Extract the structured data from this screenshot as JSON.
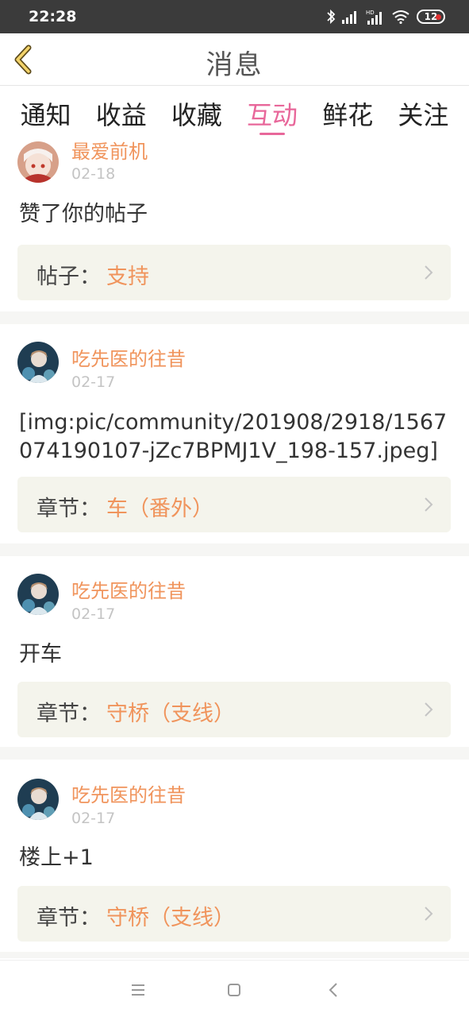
{
  "status_bar": {
    "time": "22:28",
    "battery": "12"
  },
  "header": {
    "title": "消息"
  },
  "tabs": [
    {
      "label": "通知",
      "active": false
    },
    {
      "label": "收益",
      "active": false
    },
    {
      "label": "收藏",
      "active": false
    },
    {
      "label": "互动",
      "active": true
    },
    {
      "label": "鲜花",
      "active": false
    },
    {
      "label": "关注",
      "active": false
    }
  ],
  "messages": [
    {
      "author": "最爱前机",
      "date": "02-18",
      "content": "赞了你的帖子",
      "ref_label": "帖子：",
      "ref_title": "支持"
    },
    {
      "author": "吃先医的往昔",
      "date": "02-17",
      "content": "[img:pic/community/201908/2918/1567074190107-jZc7BPMJ1V_198-157.jpeg]",
      "ref_label": "章节：",
      "ref_title": "车（番外）"
    },
    {
      "author": "吃先医的往昔",
      "date": "02-17",
      "content": "开车",
      "ref_label": "章节：",
      "ref_title": "守桥（支线）"
    },
    {
      "author": "吃先医的往昔",
      "date": "02-17",
      "content": "楼上+1",
      "ref_label": "章节：",
      "ref_title": "守桥（支线）"
    }
  ],
  "colors": {
    "accent_pink": "#e8679a",
    "accent_orange": "#f0945c",
    "ref_bg": "#f4f4ec"
  }
}
